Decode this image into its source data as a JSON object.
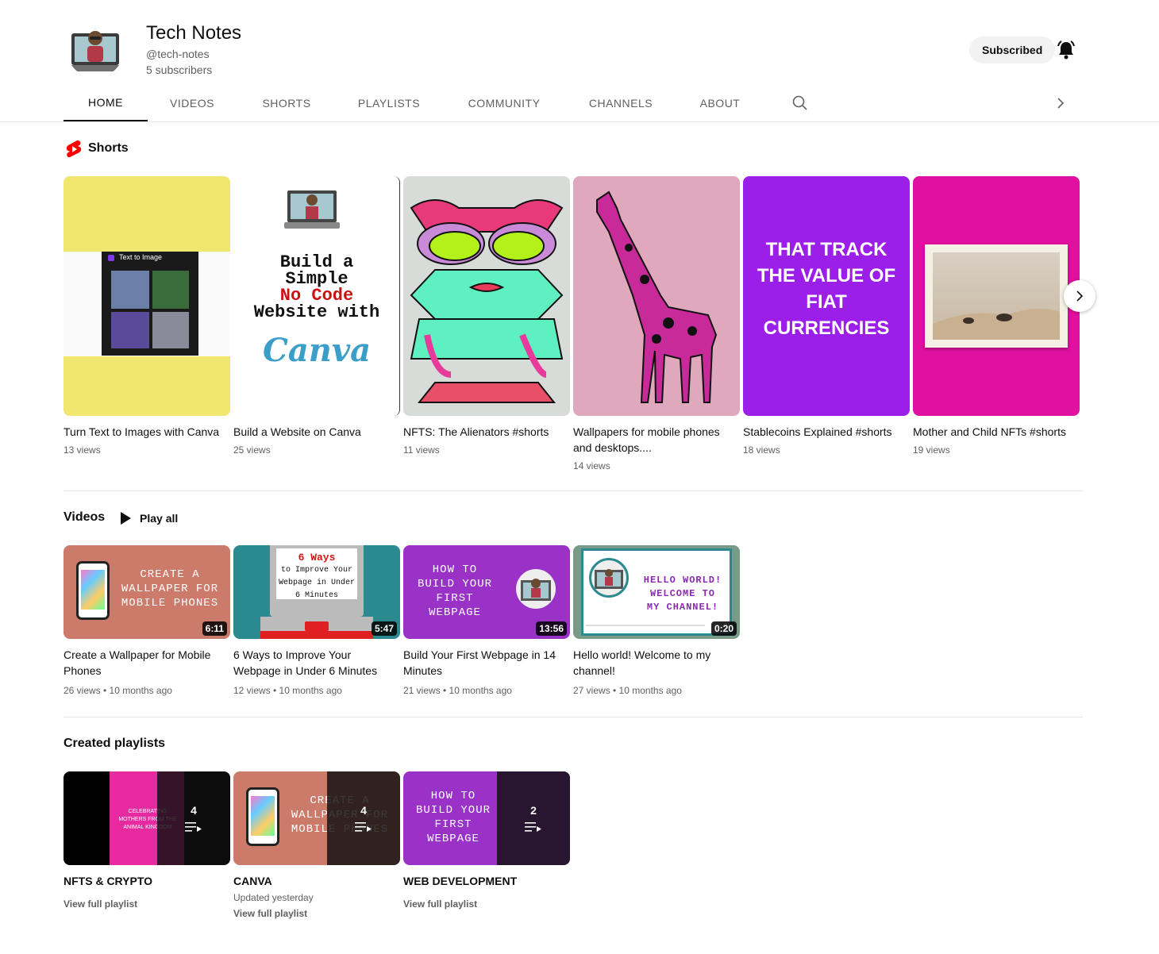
{
  "channel": {
    "title": "Tech Notes",
    "handle": "@tech-notes",
    "subscribers": "5 subscribers",
    "subscribe_label": "Subscribed"
  },
  "tabs": [
    "HOME",
    "VIDEOS",
    "SHORTS",
    "PLAYLISTS",
    "COMMUNITY",
    "CHANNELS",
    "ABOUT"
  ],
  "shorts": {
    "heading": "Shorts",
    "items": [
      {
        "title": "Turn Text to Images with Canva",
        "views": "13 views",
        "thumb_text": "Text to Image"
      },
      {
        "title": "Build a Website on Canva",
        "views": "25 views",
        "thumb_line1": "Build a",
        "thumb_line2": "Simple",
        "thumb_line3": "No Code",
        "thumb_line4": "Website with",
        "thumb_brand": "Canva"
      },
      {
        "title": "NFTS: The Alienators #shorts",
        "views": "11 views"
      },
      {
        "title": "Wallpapers for mobile phones and desktops....",
        "views": "14 views"
      },
      {
        "title": "Stablecoins Explained #shorts",
        "views": "18 views",
        "thumb_line1": "THAT TRACK",
        "thumb_line2": "THE VALUE OF",
        "thumb_line3": "FIAT",
        "thumb_line4": "CURRENCIES"
      },
      {
        "title": "Mother and Child NFTs #shorts",
        "views": "19 views"
      }
    ]
  },
  "videos": {
    "heading": "Videos",
    "play_all": "Play all",
    "items": [
      {
        "title": "Create a Wallpaper for Mobile Phones",
        "meta": "26 views • 10 months ago",
        "duration": "6:11",
        "thumb_line1": "CREATE A",
        "thumb_line2": "WALLPAPER FOR",
        "thumb_line3": "MOBILE PHONES"
      },
      {
        "title": "6 Ways to Improve Your Webpage in Under 6 Minutes",
        "meta": "12 views • 10 months ago",
        "duration": "5:47",
        "thumb_line1": "6 Ways",
        "thumb_line2": "to Improve Your",
        "thumb_line3": "Webpage in Under",
        "thumb_line4": "6 Minutes"
      },
      {
        "title": "Build Your First Webpage in 14 Minutes",
        "meta": "21 views • 10 months ago",
        "duration": "13:56",
        "thumb_line1": "HOW TO",
        "thumb_line2": "BUILD YOUR",
        "thumb_line3": "FIRST",
        "thumb_line4": "WEBPAGE"
      },
      {
        "title": "Hello world! Welcome to my channel!",
        "meta": "27 views • 10 months ago",
        "duration": "0:20",
        "thumb_line1": "HELLO WORLD!",
        "thumb_line2": "WELCOME TO",
        "thumb_line3": "MY CHANNEL!"
      }
    ]
  },
  "playlists": {
    "heading": "Created playlists",
    "items": [
      {
        "title": "NFTS & CRYPTO",
        "count": "4",
        "updated": "",
        "link": "View full playlist",
        "thumb_text": "CELEBRATING MOTHERS FROM THE ANIMAL KINGDOM"
      },
      {
        "title": "CANVA",
        "count": "4",
        "updated": "Updated yesterday",
        "link": "View full playlist"
      },
      {
        "title": "WEB DEVELOPMENT",
        "count": "2",
        "updated": "",
        "link": "View full playlist"
      }
    ]
  },
  "colors": {
    "accent_red": "#ff0000",
    "text_primary": "#0f0f0f",
    "text_secondary": "#606060"
  }
}
